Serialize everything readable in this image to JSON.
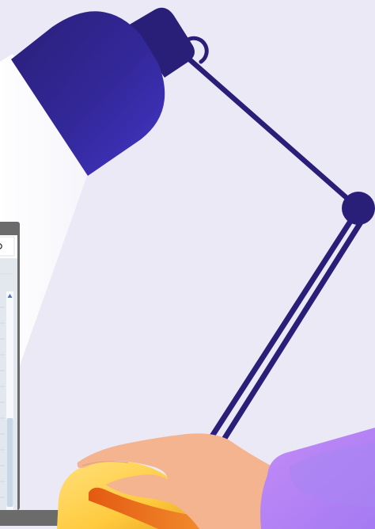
{
  "colors": {
    "background": "#ECE9F6",
    "lamp_primary": "#2A1F78",
    "lamp_shade_light": "#3F35C4",
    "light_beam": "#F8F7FC",
    "hand_skin": "#F4B48F",
    "mouse_yellow": "#FFD54F",
    "mouse_orange": "#F08A28",
    "sleeve_purple": "#B283F5",
    "monitor_frame": "#6B6B6B",
    "screen_panel": "#E3E8EE",
    "scrollbar_track": "#F6F8FB",
    "scrollbar_thumb": "#C8D6E6",
    "scroll_arrow": "#4A73C8"
  },
  "icons": {
    "lamp": "desk-lamp-illustration",
    "hand": "hand-on-mouse-illustration",
    "monitor": "partial-monitor-illustration",
    "scroll_up": "scroll-up-arrow-icon"
  }
}
